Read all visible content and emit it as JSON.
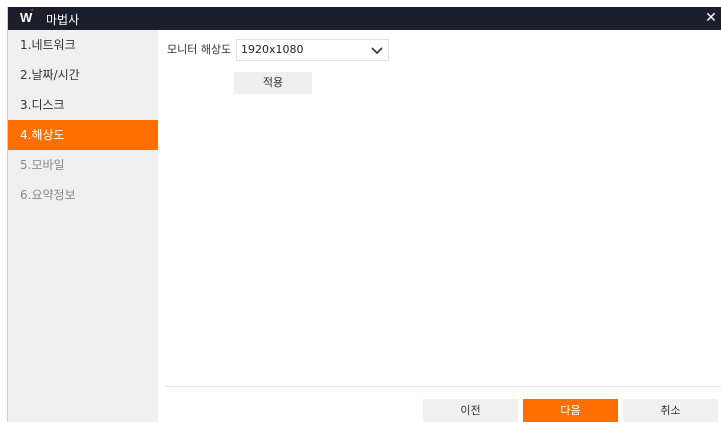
{
  "window": {
    "logo": "W",
    "logo_mark": "'",
    "title": "마법사",
    "close_icon": "close-icon"
  },
  "sidebar": {
    "items": [
      {
        "label": "1.네트워크",
        "state": "normal"
      },
      {
        "label": "2.날짜/시간",
        "state": "normal"
      },
      {
        "label": "3.디스크",
        "state": "normal"
      },
      {
        "label": "4.해상도",
        "state": "active"
      },
      {
        "label": "5.모바일",
        "state": "disabled"
      },
      {
        "label": "6.요약정보",
        "state": "disabled"
      }
    ]
  },
  "resolution": {
    "label": "모니터 해상도",
    "selected": "1920x1080",
    "apply_label": "적용"
  },
  "footer": {
    "prev_label": "이전",
    "next_label": "다음",
    "cancel_label": "취소"
  },
  "colors": {
    "accent": "#ff6f00",
    "titlebar": "#1b1f2b",
    "sidebar_bg": "#f0f0f0"
  }
}
